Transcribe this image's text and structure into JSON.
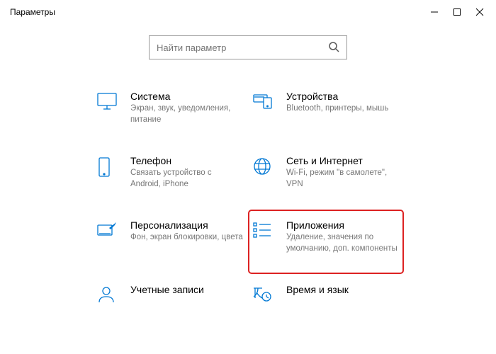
{
  "window": {
    "title": "Параметры"
  },
  "search": {
    "placeholder": "Найти параметр"
  },
  "tiles": {
    "system": {
      "title": "Система",
      "desc": "Экран, звук, уведомления, питание"
    },
    "devices": {
      "title": "Устройства",
      "desc": "Bluetooth, принтеры, мышь"
    },
    "phone": {
      "title": "Телефон",
      "desc": "Связать устройство с Android, iPhone"
    },
    "network": {
      "title": "Сеть и Интернет",
      "desc": "Wi-Fi, режим \"в самолете\", VPN"
    },
    "personalization": {
      "title": "Персонализация",
      "desc": "Фон, экран блокировки, цвета"
    },
    "apps": {
      "title": "Приложения",
      "desc": "Удаление, значения по умолчанию, доп. компоненты"
    },
    "accounts": {
      "title": "Учетные записи",
      "desc": ""
    },
    "time": {
      "title": "Время и язык",
      "desc": ""
    }
  },
  "colors": {
    "accent": "#0078d4",
    "highlight": "#d22"
  }
}
